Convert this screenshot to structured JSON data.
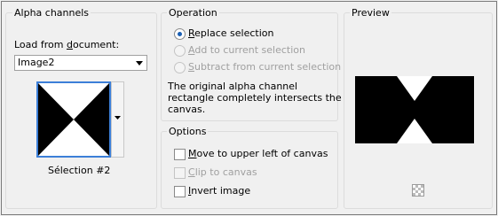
{
  "alpha": {
    "title": "Alpha channels",
    "load_label_pre": "Load from ",
    "load_label_u": "d",
    "load_label_post": "ocument:",
    "document_value": "Image2",
    "selection_name": "Sélection #2"
  },
  "operation": {
    "title": "Operation",
    "replace": {
      "u": "R",
      "rest": "eplace selection",
      "checked": true,
      "enabled": true
    },
    "add": {
      "u": "A",
      "rest": "dd to current selection",
      "enabled": false
    },
    "subtract": {
      "u": "S",
      "rest": "ubtract from current selection",
      "enabled": false
    },
    "message": [
      "The original alpha channel",
      "rectangle completely intersects the",
      "canvas."
    ]
  },
  "options": {
    "title": "Options",
    "move": {
      "u": "M",
      "rest": "ove to upper left of canvas",
      "checked": false,
      "enabled": true
    },
    "clip": {
      "u": "C",
      "rest": "lip to canvas",
      "checked": false,
      "enabled": false
    },
    "invert": {
      "u": "I",
      "rest": "nvert image",
      "checked": false,
      "enabled": true
    }
  },
  "preview": {
    "title": "Preview"
  }
}
